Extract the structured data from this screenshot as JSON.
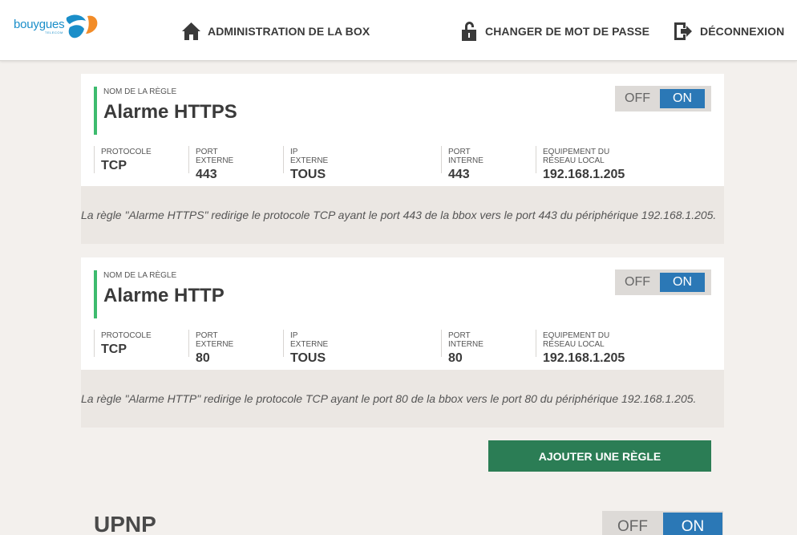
{
  "brand": {
    "name": "bouygues",
    "subtitle": "TELECOM"
  },
  "nav": {
    "admin": {
      "label": "ADMINISTRATION DE LA BOX",
      "icon": "home-icon"
    },
    "password": {
      "label": "CHANGER DE MOT DE PASSE",
      "icon": "lock-icon"
    },
    "logout": {
      "label": "DÉCONNEXION",
      "icon": "logout-icon"
    }
  },
  "rule_name_label": "NOM DE LA RÈGLE",
  "columns": {
    "protocol": "PROTOCOLE",
    "external_port": "PORT EXTERNE",
    "external_ip": "IP EXTERNE",
    "internal_port": "PORT INTERNE",
    "local_device": "EQUIPEMENT DU RÉSEAU LOCAL"
  },
  "toggle": {
    "off": "OFF",
    "on": "ON"
  },
  "rules": [
    {
      "name": "Alarme HTTPS",
      "state": "ON",
      "protocol": "TCP",
      "external_port": "443",
      "external_ip": "TOUS",
      "internal_port": "443",
      "local_device": "192.168.1.205",
      "description": "La règle \"Alarme HTTPS\" redirige le protocole TCP ayant le port 443 de la bbox vers le port 443 du périphérique 192.168.1.205."
    },
    {
      "name": "Alarme HTTP",
      "state": "ON",
      "protocol": "TCP",
      "external_port": "80",
      "external_ip": "TOUS",
      "internal_port": "80",
      "local_device": "192.168.1.205",
      "description": "La règle \"Alarme HTTP\" redirige le protocole TCP ayant le port 80 de la bbox vers le port 80 du périphérique 192.168.1.205."
    }
  ],
  "add_rule_button": "AJOUTER UNE RÈGLE",
  "upnp": {
    "title": "UPNP",
    "state": "ON"
  },
  "colors": {
    "accent_blue": "#2b78b6",
    "accent_green": "#3dbb6e",
    "button_green": "#2b7d55",
    "page_bg": "#f3f0ed",
    "brand_blue": "#1a8ec9",
    "brand_orange": "#f28c28"
  }
}
